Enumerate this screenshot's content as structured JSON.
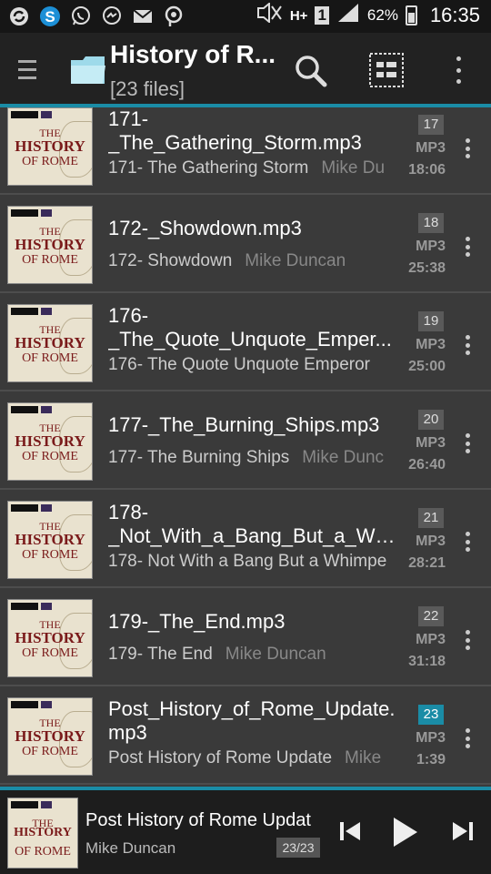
{
  "status_bar": {
    "battery": "62%",
    "time": "16:35",
    "network": "H+",
    "sim": "1"
  },
  "action_bar": {
    "title": "History of R...",
    "subtitle": "[23 files]"
  },
  "files": [
    {
      "title_lines": [
        "171-",
        "_The_Gathering_Storm.mp3"
      ],
      "track": "171- The Gathering Storm",
      "artist": "Mike Du",
      "num": "17",
      "format": "MP3",
      "duration": "18:06"
    },
    {
      "title_lines": [
        "172-_Showdown.mp3"
      ],
      "track": "172- Showdown",
      "artist": "Mike Duncan",
      "num": "18",
      "format": "MP3",
      "duration": "25:38"
    },
    {
      "title_lines": [
        "176-",
        "_The_Quote_Unquote_Emper..."
      ],
      "track": "176- The Quote Unquote Emperor",
      "artist": "",
      "num": "19",
      "format": "MP3",
      "duration": "25:00"
    },
    {
      "title_lines": [
        "177-_The_Burning_Ships.mp3"
      ],
      "track": "177- The Burning Ships",
      "artist": "Mike Dunc",
      "num": "20",
      "format": "MP3",
      "duration": "26:40"
    },
    {
      "title_lines": [
        "178-",
        "_Not_With_a_Bang_But_a_Wh..."
      ],
      "track": "178- Not With a Bang But a Whimpe",
      "artist": "",
      "num": "21",
      "format": "MP3",
      "duration": "28:21"
    },
    {
      "title_lines": [
        "179-_The_End.mp3"
      ],
      "track": "179- The End",
      "artist": "Mike Duncan",
      "num": "22",
      "format": "MP3",
      "duration": "31:18"
    },
    {
      "title_lines": [
        "Post_History_of_Rome_Update.",
        "mp3"
      ],
      "track": "Post History of Rome Update",
      "artist": "Mike",
      "num": "23",
      "format": "MP3",
      "duration": "1:39",
      "current": true
    }
  ],
  "thumbnail": {
    "line1": "THE",
    "line2": "HISTORY",
    "line3": "OF ROME"
  },
  "player": {
    "title": "Post History of Rome Updat",
    "artist": "Mike Duncan",
    "position": "23/23"
  },
  "colors": {
    "accent": "#1a8ca6",
    "background": "#3a3a3a"
  }
}
